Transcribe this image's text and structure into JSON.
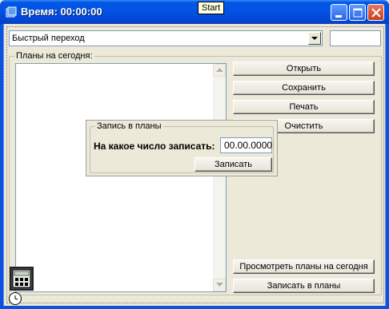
{
  "window": {
    "title": "Время: 00:00:00"
  },
  "tooltip": {
    "text": "Start"
  },
  "navigation": {
    "combo_value": "Быстрый переход",
    "side_input_value": ""
  },
  "plans": {
    "group_label": "Планы на сегодня:",
    "items": []
  },
  "buttons": {
    "open": "Открыть",
    "save": "Сохранить",
    "print": "Печать",
    "clear": "Очистить",
    "view_today": "Просмотреть планы на сегодня",
    "write_plans": "Записать в планы"
  },
  "write_dialog": {
    "group_label": "Запись в планы",
    "question": "На какое число записать:",
    "date_value": "00.00.0000",
    "submit": "Записать"
  },
  "colors": {
    "titlebar": "#0054e3",
    "face": "#ece9d8",
    "close_button": "#d9532f"
  },
  "icons": {
    "app": "book-icon",
    "minimize": "minimize-icon",
    "maximize": "maximize-icon",
    "close": "close-icon",
    "combo_arrow": "chevron-down-icon",
    "scroll_up": "arrow-up-icon",
    "scroll_down": "arrow-down-icon",
    "calculator": "calculator-icon",
    "clock": "clock-icon"
  }
}
